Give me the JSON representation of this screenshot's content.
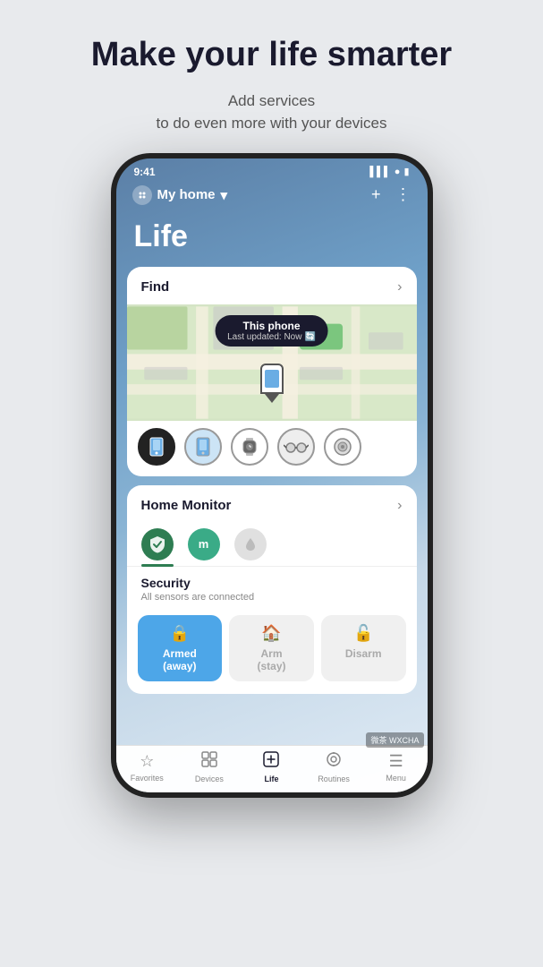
{
  "hero": {
    "title": "Make your life smarter",
    "subtitle": "Add services\nto do even more with your devices"
  },
  "phone": {
    "status": {
      "time": "9:41",
      "battery": "●●●",
      "signal": "▌▌▌"
    },
    "topbar": {
      "home_label": "My home",
      "dropdown_icon": "▾",
      "add_icon": "+",
      "more_icon": "⋮"
    },
    "page_title": "Life",
    "find_card": {
      "title": "Find",
      "arrow": "›",
      "tooltip_title": "This phone",
      "tooltip_sub": "Last updated: Now"
    },
    "device_icons": [
      "📱",
      "📱",
      "⌚",
      "👓",
      "⏱"
    ],
    "home_monitor": {
      "title": "Home Monitor",
      "arrow": "›",
      "tabs": [
        {
          "icon": "🛡",
          "active": true,
          "color": "green"
        },
        {
          "icon": "m",
          "active": false,
          "color": "teal"
        },
        {
          "icon": "💧",
          "active": false,
          "color": "gray"
        }
      ],
      "security_title": "Security",
      "security_sub": "All sensors are connected",
      "buttons": [
        {
          "label": "Armed\n(away)",
          "active": true,
          "icon": "🔒"
        },
        {
          "label": "Arm\n(stay)",
          "active": false,
          "icon": "🏠"
        },
        {
          "label": "Disarm",
          "active": false,
          "icon": "🔓"
        }
      ]
    },
    "bottom_nav": [
      {
        "label": "Favorites",
        "icon": "☆",
        "active": false
      },
      {
        "label": "Devices",
        "icon": "⊞",
        "active": false
      },
      {
        "label": "Life",
        "icon": "⊡",
        "active": true
      },
      {
        "label": "Routines",
        "icon": "⊙",
        "active": false
      },
      {
        "label": "Menu",
        "icon": "≡",
        "active": false
      }
    ]
  },
  "watermark": "微茶 WXCHA"
}
